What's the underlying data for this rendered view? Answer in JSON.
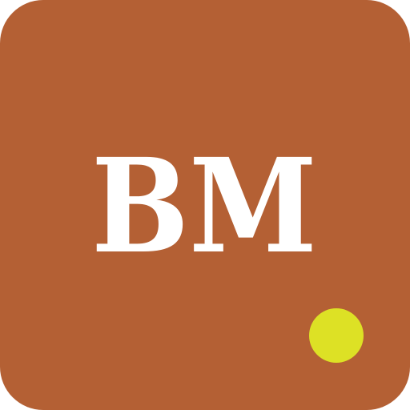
{
  "icon": {
    "monogram": "BM",
    "background_color": "#b46034",
    "text_color": "#ffffff"
  },
  "status_indicator": {
    "color": "#dde125"
  }
}
